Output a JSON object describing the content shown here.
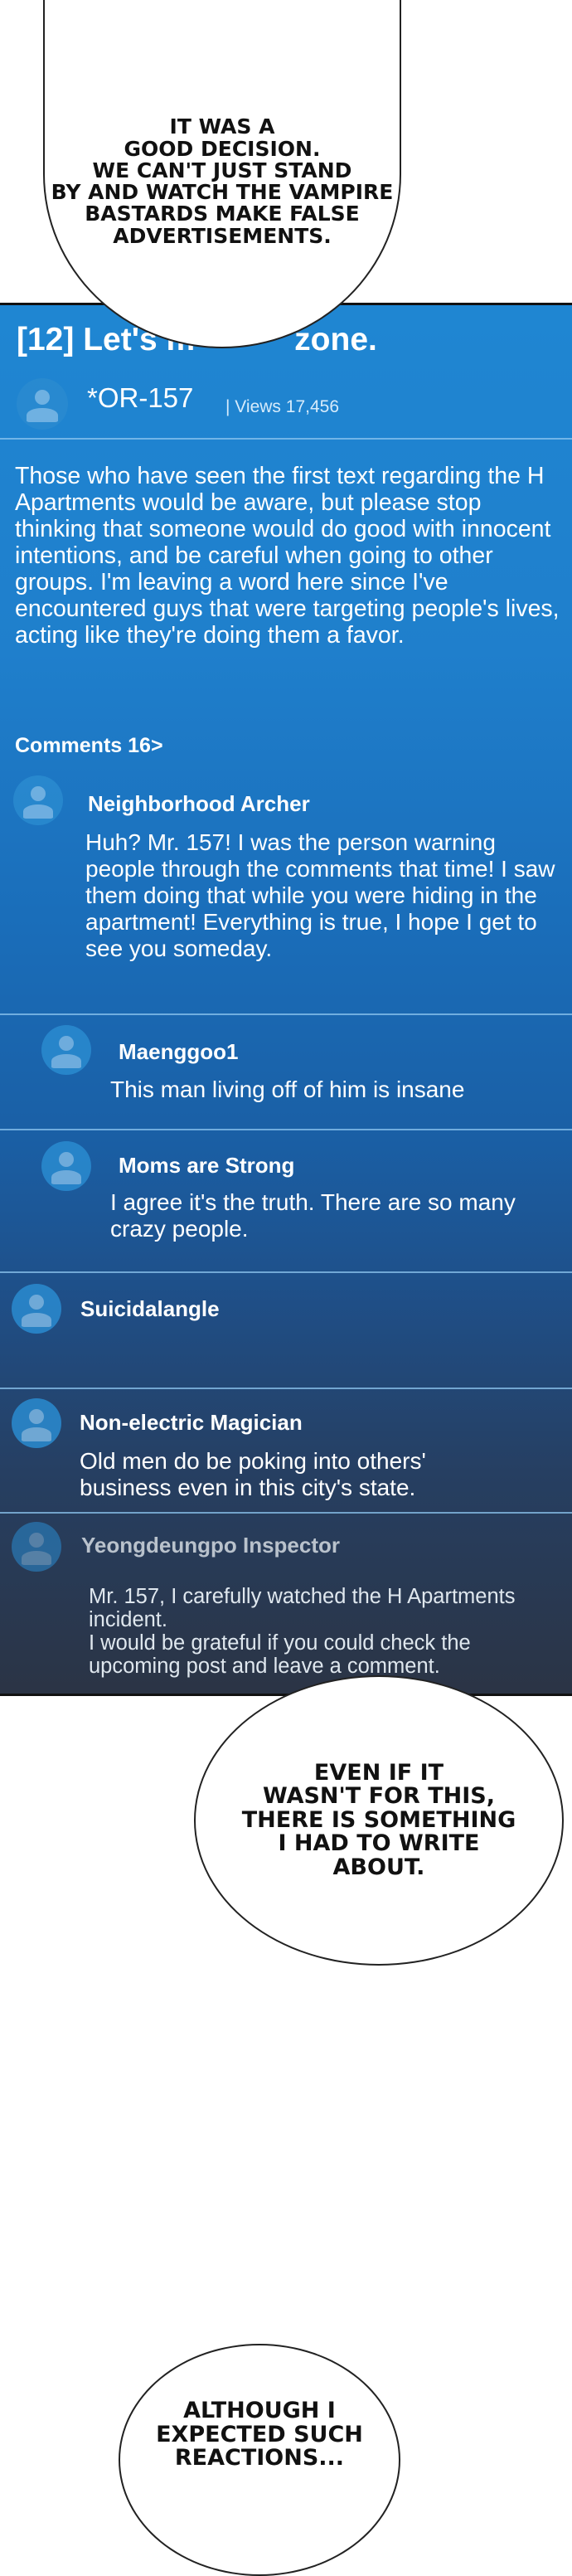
{
  "bubbles": [
    {
      "text": "It was a\ngood decision.\nWe can't just stand\nby and watch the vampire\nbastards make false\nadvertisements."
    },
    {
      "text": "Even if it\nwasn't for this,\nthere is something\nI had to write\nabout."
    },
    {
      "text": "Although I\nexpected such\nreactions..."
    }
  ],
  "post": {
    "title": "[12] Let's m",
    "title_end": "zone.",
    "author": "*OR-157",
    "views": "| Views 17,456",
    "body": "Those who have seen the first text regarding the H Apartments would be aware, but please stop thinking that someone would do good with innocent intentions, and be careful when going to other groups. I'm leaving a word here since I've encountered guys that were targeting people's lives, acting like they're doing them a favor.",
    "comments_label": "Comments 16>"
  },
  "comments": [
    {
      "name": "Neighborhood Archer",
      "body": "Huh? Mr. 157! I was the person warning people through the comments that time! I saw them doing that while you were hiding in the apartment! Everything is true, I hope I get to see you someday."
    },
    {
      "name": "Maenggoo1",
      "body": "This man living off of him is insane"
    },
    {
      "name": "Moms are Strong",
      "body": "I agree it's the truth. There are so many crazy people."
    },
    {
      "name": "Suicidalangle",
      "body": ""
    },
    {
      "name": "Non-electric Magician",
      "body": "Old men do be poking into others' business even in this city's state."
    },
    {
      "name": "Yeongdeungpo Inspector",
      "body": "Mr. 157, I carefully watched the H Apartments incident.\nI would be grateful if you could check the upcoming post and leave a comment."
    }
  ]
}
